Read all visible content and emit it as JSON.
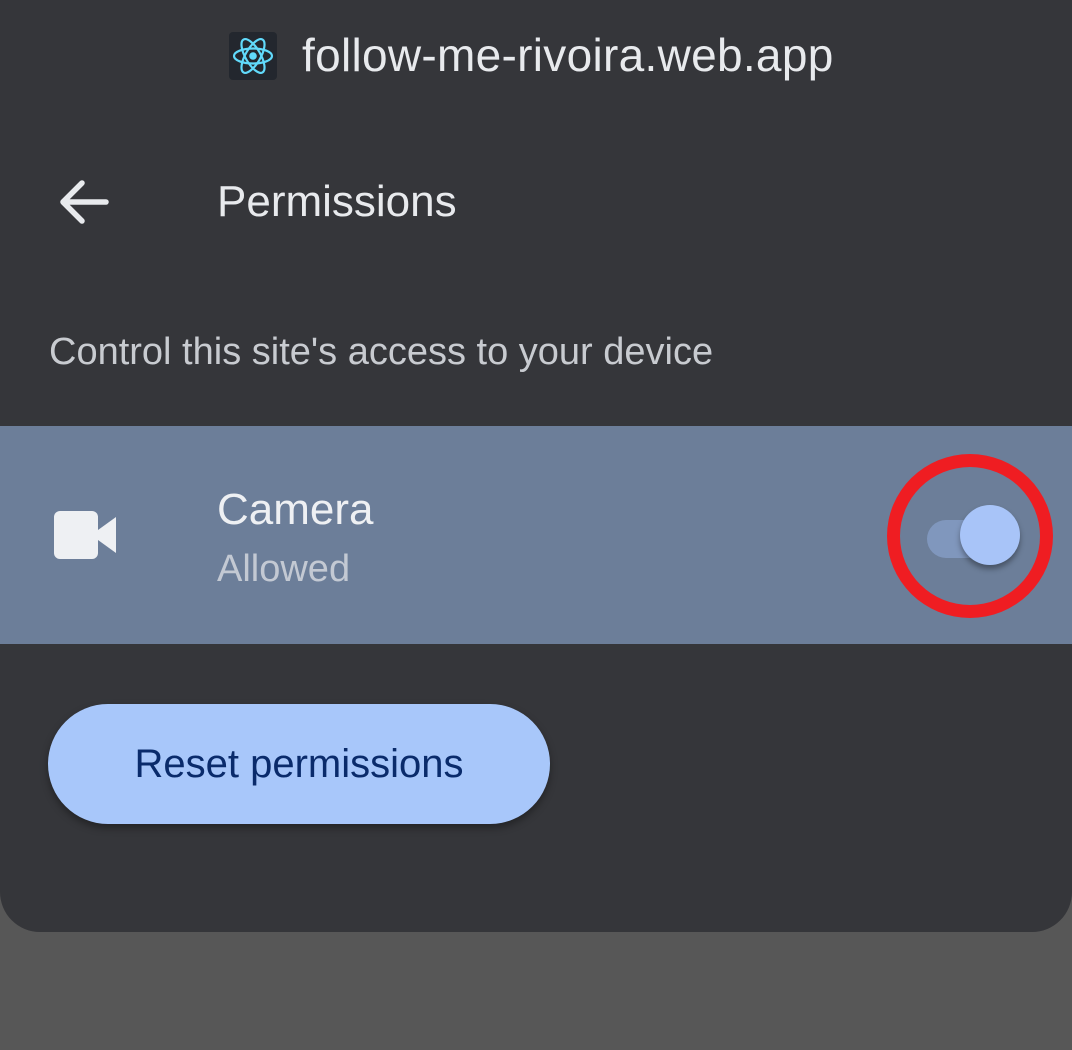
{
  "site": {
    "domain": "follow-me-rivoira.web.app",
    "favicon_icon": "react-logo-icon"
  },
  "toolbar": {
    "back_icon": "arrow-back-icon",
    "title": "Permissions"
  },
  "section": {
    "description": "Control this site's access to your device"
  },
  "permissions": [
    {
      "icon": "videocam-icon",
      "name": "Camera",
      "status": "Allowed",
      "enabled": true
    }
  ],
  "actions": {
    "reset_label": "Reset permissions"
  },
  "colors": {
    "sheet_background": "#35363a",
    "scrim": "#575757",
    "row_highlight": "#6c7e99",
    "toggle_thumb": "#a8c4f8",
    "toggle_track": "#8097bd",
    "button_fill": "#a8c7fa",
    "button_text": "#0a2b6b",
    "annotation_ring": "#ef1d22"
  }
}
